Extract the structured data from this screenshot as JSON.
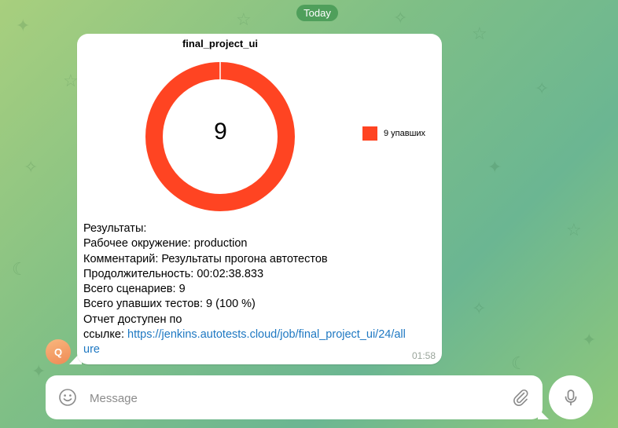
{
  "date_pill": "Today",
  "message": {
    "chart_title": "final_project_ui",
    "center_value": "9",
    "legend_label": "9 упавших",
    "lines": {
      "l1": "Результаты:",
      "l2": "Рабочее окружение: production",
      "l3": "Комментарий: Результаты прогона автотестов",
      "l4": "Продолжительность: 00:02:38.833",
      "l5": "Всего сценариев: 9",
      "l6": "Всего упавших тестов: 9 (100 %)",
      "l7": "Отчет доступен по",
      "l8_prefix": "ссылке: ",
      "link_line1": "https://jenkins.autotests.cloud/job/final_project_ui/24/all",
      "link_line2": "ure"
    },
    "time": "01:58",
    "sender_initial": "Q"
  },
  "chart_data": {
    "type": "pie",
    "title": "final_project_ui",
    "donut": true,
    "labels": [
      "9 упавших"
    ],
    "values": [
      9
    ],
    "center_label": "9",
    "legend_position": "right",
    "colors": [
      "#ff4422"
    ]
  },
  "composer": {
    "placeholder": "Message"
  },
  "icons": {
    "emoji": "smile-icon",
    "attach": "paperclip-icon",
    "mic": "microphone-icon"
  },
  "colors": {
    "accent": "#4f9f5b",
    "link": "#1e78c2",
    "failed": "#ff4422"
  }
}
